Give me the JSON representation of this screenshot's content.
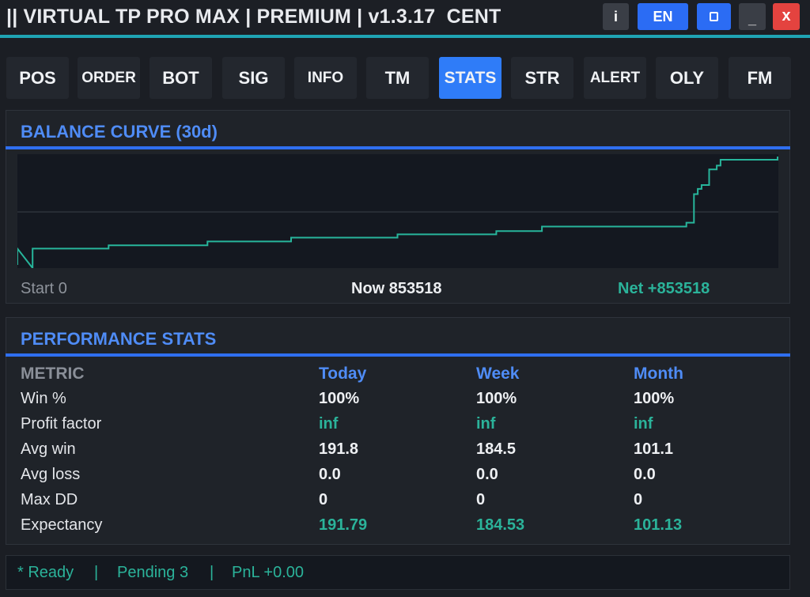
{
  "window": {
    "title": "|| VIRTUAL TP PRO MAX | PREMIUM | v1.3.17  CENT",
    "buttons": {
      "info": "i",
      "language": "EN",
      "minimize": "_",
      "close": "x"
    }
  },
  "tabs": [
    {
      "label": "POS",
      "active": false
    },
    {
      "label": "ORDER",
      "active": false
    },
    {
      "label": "BOT",
      "active": false
    },
    {
      "label": "SIG",
      "active": false
    },
    {
      "label": "INFO",
      "active": false
    },
    {
      "label": "TM",
      "active": false
    },
    {
      "label": "STATS",
      "active": true
    },
    {
      "label": "STR",
      "active": false
    },
    {
      "label": "ALERT",
      "active": false
    },
    {
      "label": "OLY",
      "active": false
    },
    {
      "label": "FM",
      "active": false
    }
  ],
  "balance": {
    "title": "BALANCE CURVE (30d)",
    "start_label": "Start 0",
    "now_label": "Now 853518",
    "net_label": "Net +853518"
  },
  "chart_data": {
    "type": "line",
    "title": "BALANCE CURVE (30d)",
    "xlabel": "",
    "ylabel": "",
    "ylim": [
      0,
      853518
    ],
    "grid": true,
    "x": [
      0,
      2,
      12,
      25,
      36,
      50,
      63,
      69,
      88,
      89,
      89.5,
      90,
      91,
      92,
      92.5,
      100
    ],
    "y": [
      0,
      150000,
      175000,
      205000,
      235000,
      260000,
      285000,
      320000,
      350000,
      570000,
      610000,
      640000,
      760000,
      790000,
      835000,
      853518
    ],
    "series": [
      {
        "color": "#27b59b"
      }
    ]
  },
  "performance": {
    "title": "PERFORMANCE STATS",
    "headers": {
      "metric": "METRIC",
      "today": "Today",
      "week": "Week",
      "month": "Month"
    },
    "rows": [
      {
        "metric": "Win %",
        "today": "100%",
        "week": "100%",
        "month": "100%",
        "accent": false
      },
      {
        "metric": "Profit factor",
        "today": "inf",
        "week": "inf",
        "month": "inf",
        "accent": true
      },
      {
        "metric": "Avg win",
        "today": "191.8",
        "week": "184.5",
        "month": "101.1",
        "accent": false
      },
      {
        "metric": "Avg loss",
        "today": "0.0",
        "week": "0.0",
        "month": "0.0",
        "accent": false
      },
      {
        "metric": "Max DD",
        "today": "0",
        "week": "0",
        "month": "0",
        "accent": false
      },
      {
        "metric": "Expectancy",
        "today": "191.79",
        "week": "184.53",
        "month": "101.13",
        "accent": true
      }
    ]
  },
  "status": {
    "ready": "* Ready",
    "sep1": "|",
    "pending": "Pending 3",
    "sep2": "|",
    "pnl": "PnL +0.00"
  },
  "colors": {
    "accent_blue": "#2f7cf8",
    "heading_blue": "#4f8cf6",
    "teal": "#2bb39a",
    "close_red": "#e4433f"
  }
}
